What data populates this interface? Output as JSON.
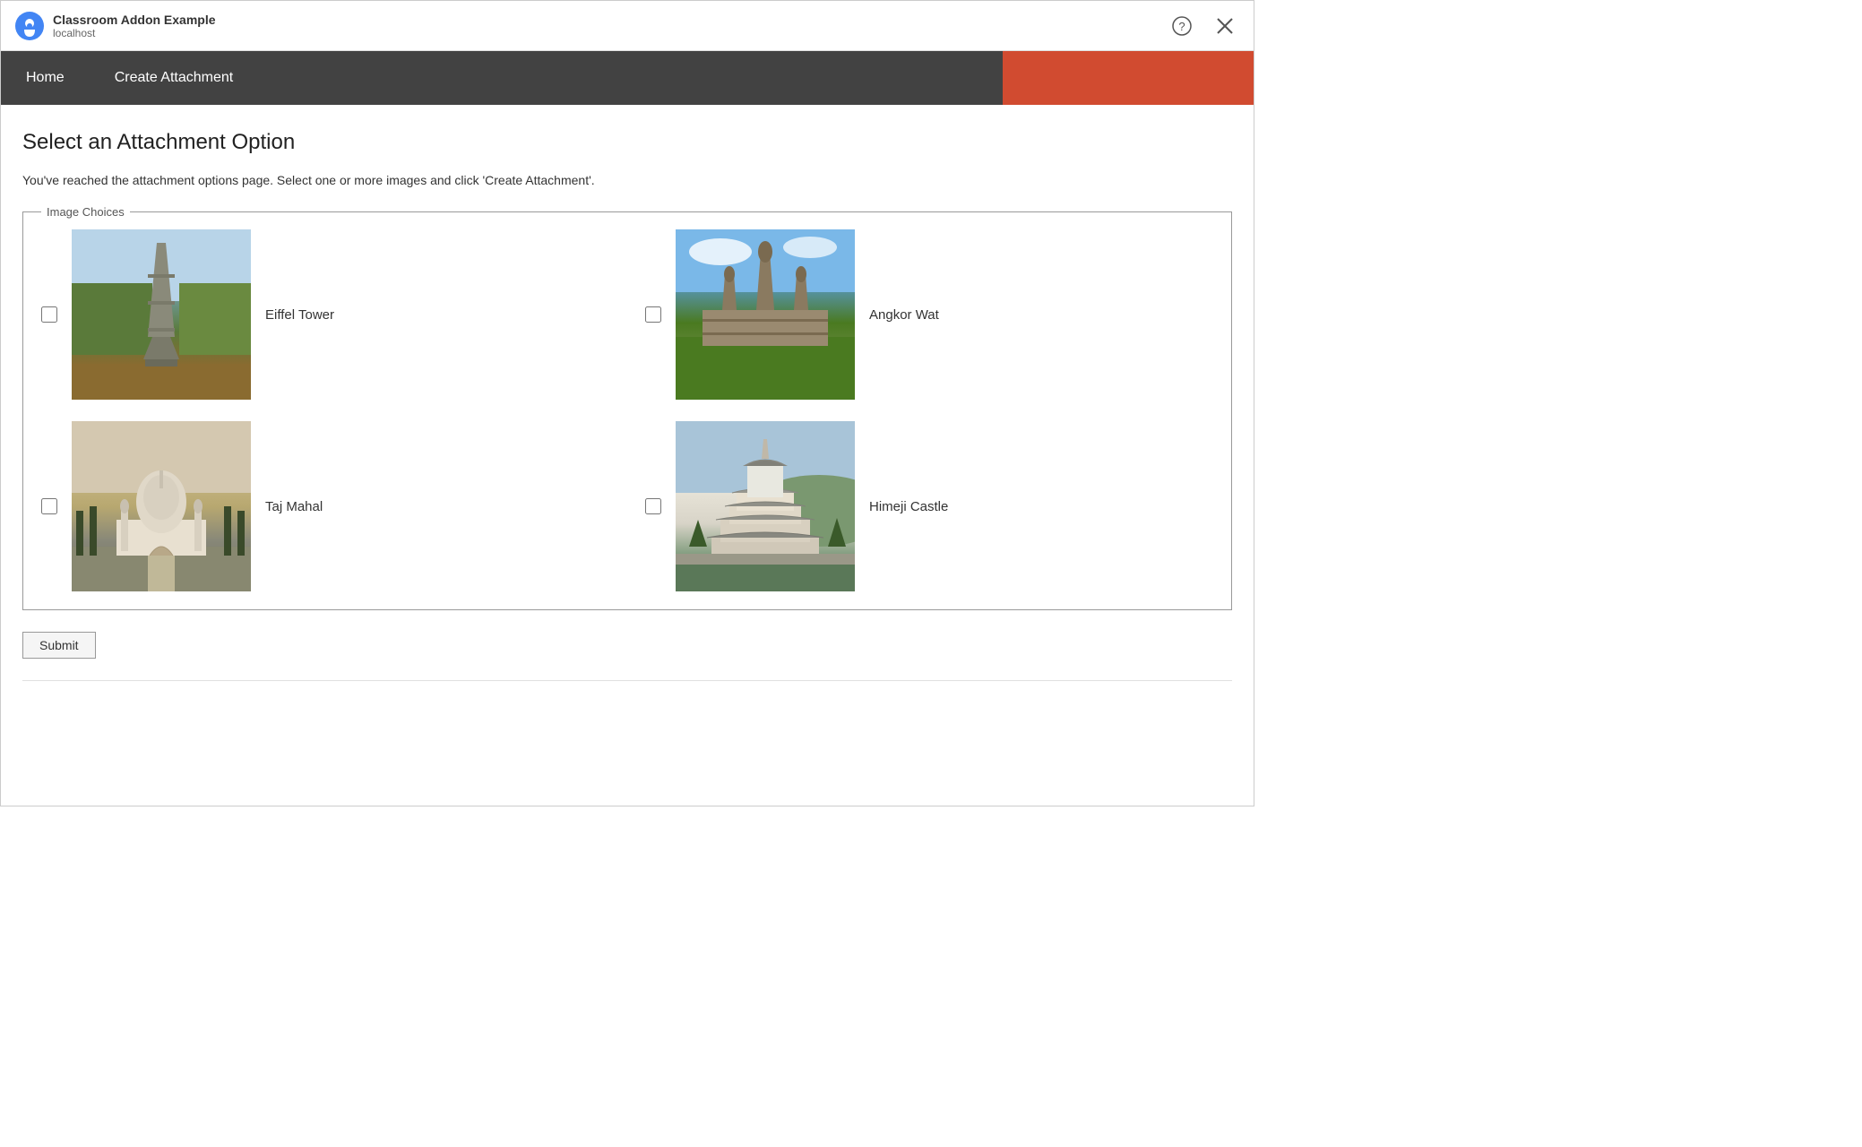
{
  "titleBar": {
    "appName": "Classroom Addon Example",
    "appUrl": "localhost",
    "helpLabel": "?",
    "closeLabel": "×"
  },
  "navBar": {
    "homeLabel": "Home",
    "createAttachmentLabel": "Create Attachment"
  },
  "mainContent": {
    "pageHeading": "Select an Attachment Option",
    "pageDescription": "You've reached the attachment options page. Select one or more images and click 'Create Attachment'.",
    "imageChoicesLegend": "Image Choices",
    "images": [
      {
        "id": "eiffel",
        "label": "Eiffel Tower",
        "checked": false
      },
      {
        "id": "angkor",
        "label": "Angkor Wat",
        "checked": false
      },
      {
        "id": "tajmahal",
        "label": "Taj Mahal",
        "checked": false
      },
      {
        "id": "himeji",
        "label": "Himeji Castle",
        "checked": false
      }
    ],
    "submitLabel": "Submit"
  },
  "colors": {
    "navBg": "#424242",
    "accentBg": "#d14b30"
  }
}
